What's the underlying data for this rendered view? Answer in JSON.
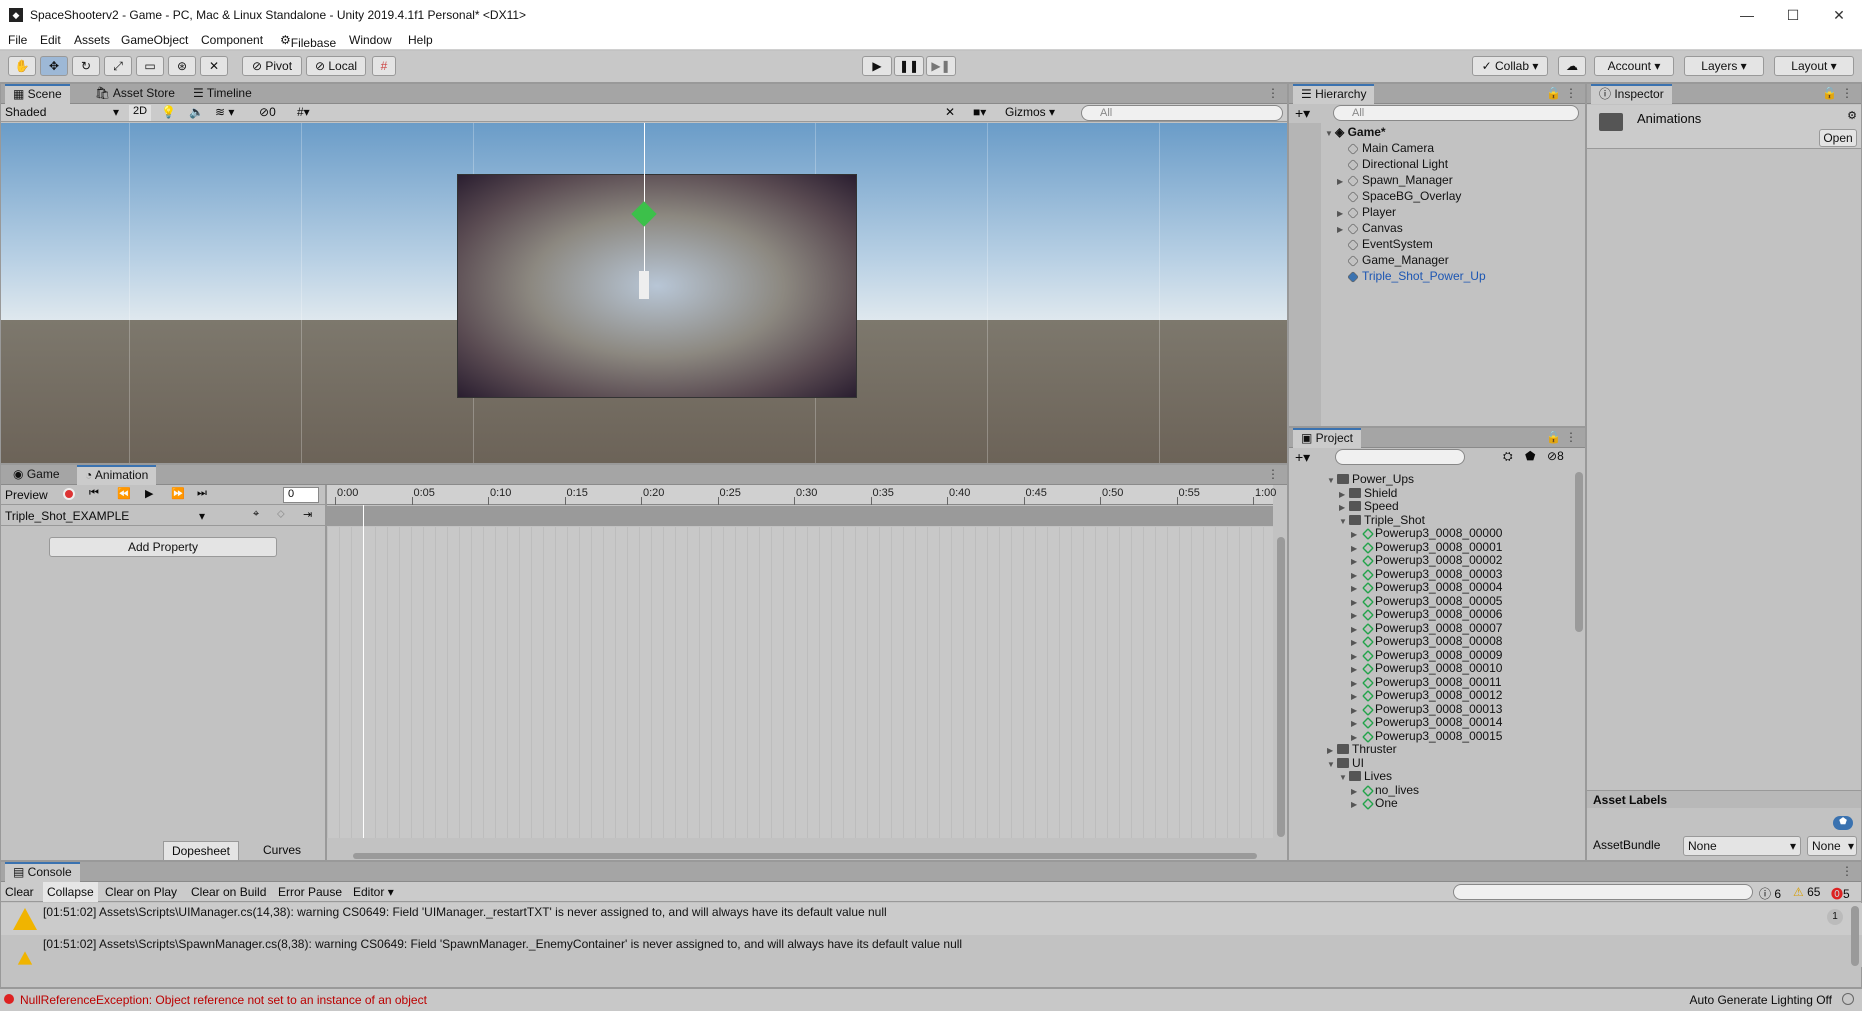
{
  "window": {
    "title": "SpaceShooterv2 - Game - PC, Mac & Linux Standalone - Unity 2019.4.1f1 Personal* <DX11>"
  },
  "menu": [
    "File",
    "Edit",
    "Assets",
    "GameObject",
    "Component",
    "Filebase",
    "Window",
    "Help"
  ],
  "toolbar": {
    "pivot": "Pivot",
    "local": "Local",
    "collab": "Collab",
    "account": "Account",
    "layers": "Layers",
    "layout": "Layout"
  },
  "scene_panel": {
    "tabs": [
      "Scene",
      "Asset Store",
      "Timeline"
    ],
    "shading": "Shaded",
    "mode_2d": "2D",
    "hidden_count": "0",
    "gizmos": "Gizmos",
    "search_placeholder": "All"
  },
  "hierarchy": {
    "tab": "Hierarchy",
    "search_placeholder": "All",
    "scene": "Game*",
    "items": [
      {
        "label": "Main Camera",
        "expandable": false
      },
      {
        "label": "Directional Light",
        "expandable": false
      },
      {
        "label": "Spawn_Manager",
        "expandable": true
      },
      {
        "label": "SpaceBG_Overlay",
        "expandable": false
      },
      {
        "label": "Player",
        "expandable": true
      },
      {
        "label": "Canvas",
        "expandable": true
      },
      {
        "label": "EventSystem",
        "expandable": false
      },
      {
        "label": "Game_Manager",
        "expandable": false
      },
      {
        "label": "Triple_Shot_Power_Up",
        "expandable": false,
        "selected": true
      }
    ]
  },
  "inspector": {
    "tab": "Inspector",
    "title": "Animations",
    "open_button": "Open",
    "asset_labels": "Asset Labels",
    "asset_bundle_label": "AssetBundle",
    "asset_bundle_value": "None",
    "asset_bundle_variant": "None"
  },
  "project": {
    "tab": "Project",
    "hidden_count": "8",
    "tree": [
      {
        "label": "Power_Ups",
        "depth": 0,
        "type": "folder",
        "open": true
      },
      {
        "label": "Shield",
        "depth": 1,
        "type": "folder",
        "open": false
      },
      {
        "label": "Speed",
        "depth": 1,
        "type": "folder",
        "open": false
      },
      {
        "label": "Triple_Shot",
        "depth": 1,
        "type": "folder",
        "open": true
      },
      {
        "label": "Powerup3_0008_00000",
        "depth": 2,
        "type": "sprite"
      },
      {
        "label": "Powerup3_0008_00001",
        "depth": 2,
        "type": "sprite"
      },
      {
        "label": "Powerup3_0008_00002",
        "depth": 2,
        "type": "sprite"
      },
      {
        "label": "Powerup3_0008_00003",
        "depth": 2,
        "type": "sprite"
      },
      {
        "label": "Powerup3_0008_00004",
        "depth": 2,
        "type": "sprite"
      },
      {
        "label": "Powerup3_0008_00005",
        "depth": 2,
        "type": "sprite"
      },
      {
        "label": "Powerup3_0008_00006",
        "depth": 2,
        "type": "sprite"
      },
      {
        "label": "Powerup3_0008_00007",
        "depth": 2,
        "type": "sprite"
      },
      {
        "label": "Powerup3_0008_00008",
        "depth": 2,
        "type": "sprite"
      },
      {
        "label": "Powerup3_0008_00009",
        "depth": 2,
        "type": "sprite"
      },
      {
        "label": "Powerup3_0008_00010",
        "depth": 2,
        "type": "sprite"
      },
      {
        "label": "Powerup3_0008_00011",
        "depth": 2,
        "type": "sprite"
      },
      {
        "label": "Powerup3_0008_00012",
        "depth": 2,
        "type": "sprite"
      },
      {
        "label": "Powerup3_0008_00013",
        "depth": 2,
        "type": "sprite"
      },
      {
        "label": "Powerup3_0008_00014",
        "depth": 2,
        "type": "sprite"
      },
      {
        "label": "Powerup3_0008_00015",
        "depth": 2,
        "type": "sprite"
      },
      {
        "label": "Thruster",
        "depth": 0,
        "type": "folder",
        "open": false
      },
      {
        "label": "UI",
        "depth": 0,
        "type": "folder",
        "open": true
      },
      {
        "label": "Lives",
        "depth": 1,
        "type": "folder",
        "open": true
      },
      {
        "label": "no_lives",
        "depth": 2,
        "type": "sprite"
      },
      {
        "label": "One",
        "depth": 2,
        "type": "sprite"
      }
    ]
  },
  "animation": {
    "tabs": [
      "Game",
      "Animation"
    ],
    "preview": "Preview",
    "frame": "0",
    "clip": "Triple_Shot_EXAMPLE",
    "add_property": "Add Property",
    "dopesheet": "Dopesheet",
    "curves": "Curves",
    "time_labels": [
      "0:00",
      "0:05",
      "0:10",
      "0:15",
      "0:20",
      "0:25",
      "0:30",
      "0:35",
      "0:40",
      "0:45",
      "0:50",
      "0:55",
      "1:00"
    ]
  },
  "console": {
    "tab": "Console",
    "buttons": [
      "Clear",
      "Collapse",
      "Clear on Play",
      "Clear on Build",
      "Error Pause",
      "Editor"
    ],
    "info_count": "6",
    "warn_count": "65",
    "error_count": "5",
    "messages": [
      {
        "text": "[01:51:02] Assets\\Scripts\\UIManager.cs(14,38): warning CS0649: Field 'UIManager._restartTXT' is never assigned to, and will always have its default value null",
        "count": "1"
      },
      {
        "text": "[01:51:02] Assets\\Scripts\\SpawnManager.cs(8,38): warning CS0649: Field 'SpawnManager._EnemyContainer' is never assigned to, and will always have its default value null",
        "count": ""
      }
    ]
  },
  "status": {
    "error": "NullReferenceException: Object reference not set to an instance of an object",
    "lighting": "Auto Generate Lighting Off"
  }
}
